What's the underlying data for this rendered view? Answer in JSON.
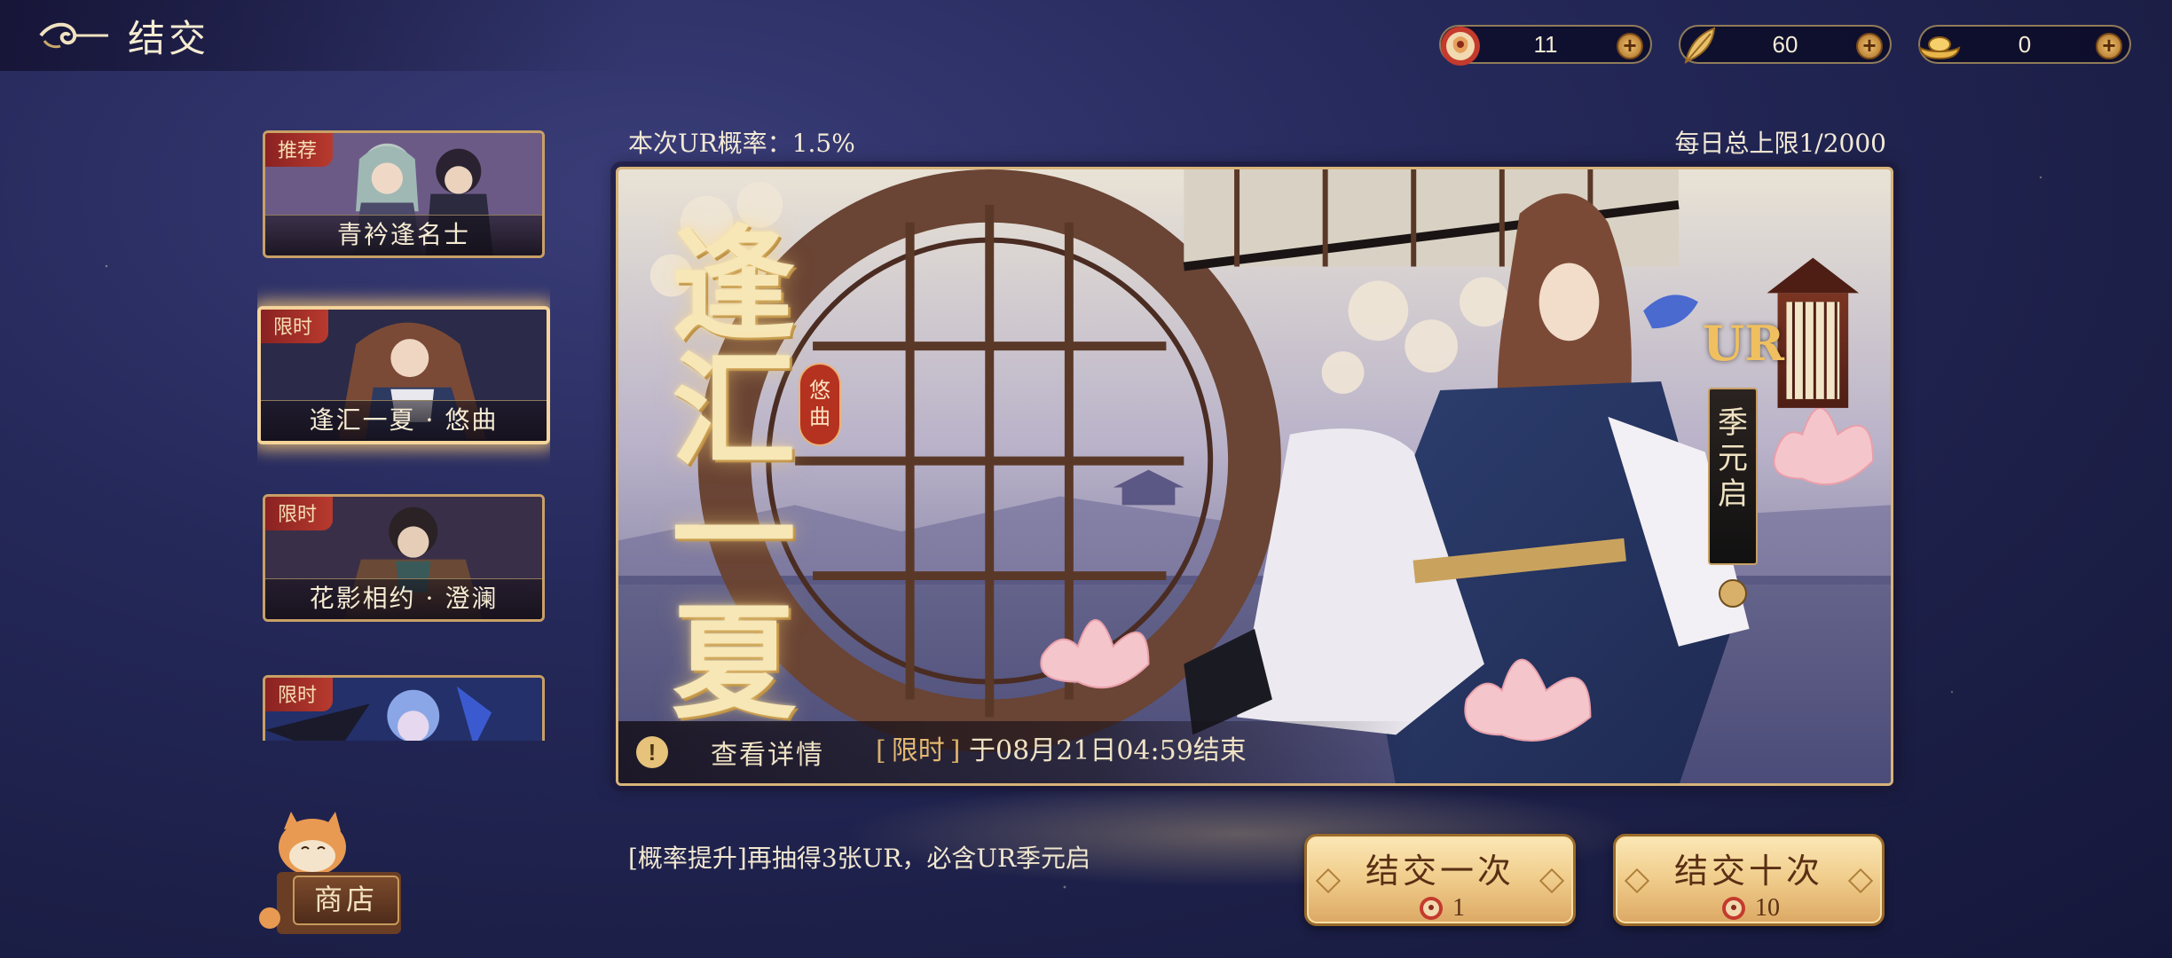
{
  "header": {
    "title": "结交"
  },
  "currency": [
    {
      "icon": "token-pouch-icon",
      "value": "11"
    },
    {
      "icon": "feather-leaf-icon",
      "value": "60"
    },
    {
      "icon": "gold-ingot-icon",
      "value": "0"
    }
  ],
  "banners": [
    {
      "tag": "推荐",
      "label": "青衿逢名士",
      "active": false
    },
    {
      "tag": "限时",
      "label": "逢汇一夏 · 悠曲",
      "active": true
    },
    {
      "tag": "限时",
      "label": "花影相约 · 澄澜",
      "active": false
    },
    {
      "tag": "限时",
      "label": "",
      "active": false
    }
  ],
  "info": {
    "ur_rate": "本次UR概率：1.5%",
    "daily_limit": "每日总上限1/2000"
  },
  "main_banner": {
    "title_chars": [
      "逢",
      "汇",
      "一",
      "夏"
    ],
    "subtitle": "悠曲",
    "ur_label": "UR",
    "character_name": "季元启",
    "details_label": "查看详情",
    "time_tag": "限时",
    "time_text": "于08月21日04:59结束"
  },
  "rate_up_text": "[概率提升]再抽得3张UR，必含UR季元启",
  "shop": {
    "label": "商店"
  },
  "draw_buttons": [
    {
      "label": "结交一次",
      "cost": "1",
      "cost_icon": "token-pouch-icon"
    },
    {
      "label": "结交十次",
      "cost": "10",
      "cost_icon": "token-pouch-icon"
    }
  ],
  "colors": {
    "accent_gold": "#d8b47a",
    "tag_red": "#b83a2e",
    "bg_navy": "#262a5c"
  }
}
